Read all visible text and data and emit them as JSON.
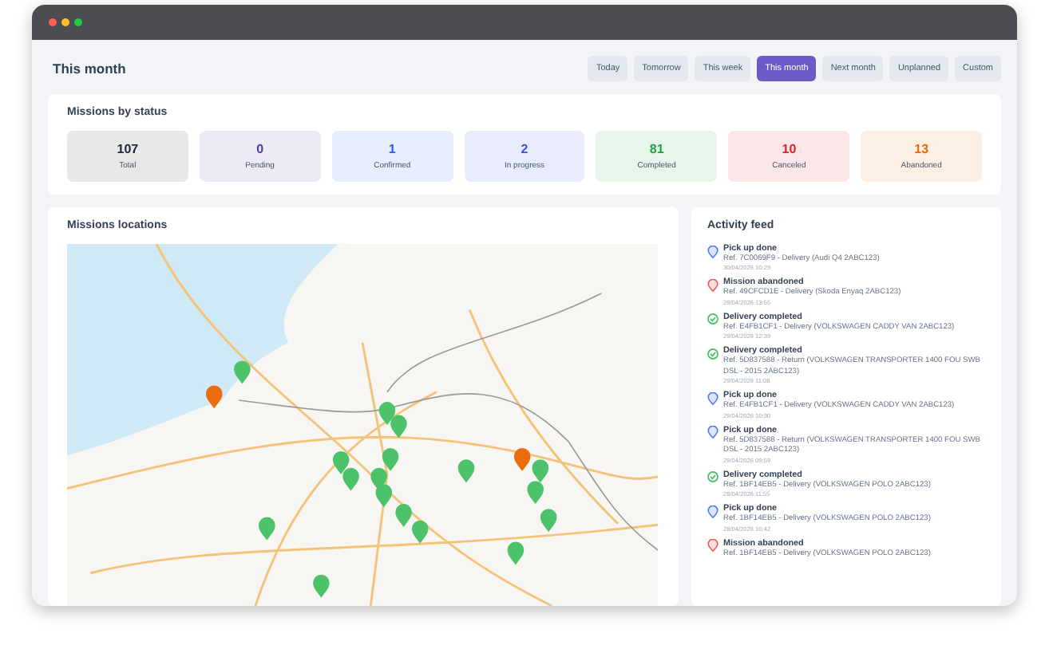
{
  "page": {
    "title": "This month"
  },
  "filters": [
    {
      "label": "Today",
      "selected": false
    },
    {
      "label": "Tomorrow",
      "selected": false
    },
    {
      "label": "This week",
      "selected": false
    },
    {
      "label": "This month",
      "selected": true
    },
    {
      "label": "Next month",
      "selected": false
    },
    {
      "label": "Unplanned",
      "selected": false
    },
    {
      "label": "Custom",
      "selected": false
    }
  ],
  "status_card": {
    "title": "Missions by status",
    "stats": [
      {
        "value": "107",
        "label": "Total",
        "color": "#1e293b"
      },
      {
        "value": "0",
        "label": "Pending",
        "color": "#4c3fa8"
      },
      {
        "value": "1",
        "label": "Confirmed",
        "color": "#2563eb"
      },
      {
        "value": "2",
        "label": "In progress",
        "color": "#3b4fe0"
      },
      {
        "value": "81",
        "label": "Completed",
        "color": "#22a04b"
      },
      {
        "value": "10",
        "label": "Canceled",
        "color": "#dc2626"
      },
      {
        "value": "13",
        "label": "Abandoned",
        "color": "#ea6c0c"
      }
    ]
  },
  "map_card": {
    "title": "Missions locations",
    "kind": "picture"
  },
  "activity_feed": {
    "title": "Activity feed",
    "items": [
      {
        "kind": "pickup",
        "title": "Pick up done",
        "ref": "Ref. 7C0069F9 - Delivery (Audi Q4 2ABC123)",
        "date": "30/04/2026 10:29"
      },
      {
        "kind": "abandoned",
        "title": "Mission abandoned",
        "ref": "Ref. 49CFCD1E - Delivery (Skoda Enyaq 2ABC123)",
        "date": "29/04/2026 13:55"
      },
      {
        "kind": "completed",
        "title": "Delivery completed",
        "ref": "Ref. E4FB1CF1 - Delivery (VOLKSWAGEN CADDY VAN 2ABC123)",
        "date": "29/04/2026 12:39"
      },
      {
        "kind": "completed",
        "title": "Delivery completed",
        "ref": "Ref. 5D837588 - Return (VOLKSWAGEN TRANSPORTER 1400 FOU SWB DSL - 2015 2ABC123)",
        "date": "29/04/2026 11:08"
      },
      {
        "kind": "pickup",
        "title": "Pick up done",
        "ref": "Ref. E4FB1CF1 - Delivery (VOLKSWAGEN CADDY VAN 2ABC123)",
        "date": "29/04/2026 10:30"
      },
      {
        "kind": "pickup",
        "title": "Pick up done",
        "ref": "Ref. 5D837588 - Return (VOLKSWAGEN TRANSPORTER 1400 FOU SWB DSL - 2015 2ABC123)",
        "date": "29/04/2026 09:59"
      },
      {
        "kind": "completed",
        "title": "Delivery completed",
        "ref": "Ref. 1BF14EB5 - Delivery (VOLKSWAGEN POLO 2ABC123)",
        "date": "28/04/2026 11:55"
      },
      {
        "kind": "pickup",
        "title": "Pick up done",
        "ref": "Ref. 1BF14EB5 - Delivery (VOLKSWAGEN POLO 2ABC123)",
        "date": "28/04/2026 10:42"
      },
      {
        "kind": "abandoned",
        "title": "Mission abandoned",
        "ref": "Ref. 1BF14EB5 - Delivery (VOLKSWAGEN POLO 2ABC123)"
      }
    ]
  }
}
